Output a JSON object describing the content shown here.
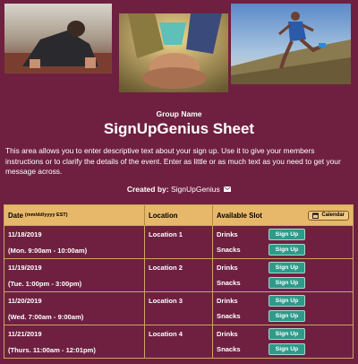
{
  "header": {
    "group_name": "Group Name",
    "title": "SignUpGenius Sheet",
    "description": "This area allows you to enter descriptive text about your sign up. Use it to give your members instructions or to clarify the details of the event. Enter as little or as much text as you need to get your message across.",
    "created_by_label": "Created by:",
    "created_by_name": "SignUpGenius",
    "mail_icon": "mail-icon"
  },
  "table": {
    "col_date": "Date",
    "col_date_format": "(mm/dd/yyyy EST)",
    "col_location": "Location",
    "col_slot": "Available Slot",
    "calendar_label": "Calendar",
    "signup_label": "Sign Up",
    "rows": [
      {
        "date": "11/18/2019",
        "time": "(Mon. 9:00am - 10:00am)",
        "location": "Location 1",
        "slots": [
          "Drinks",
          "Snacks"
        ]
      },
      {
        "date": "11/19/2019",
        "time": "(Tue. 1:00pm - 3:00pm)",
        "location": "Location 2",
        "slots": [
          "Drinks",
          "Snacks"
        ]
      },
      {
        "date": "11/20/2019",
        "time": "(Wed. 7:00am - 9:00am)",
        "location": "Location 3",
        "slots": [
          "Drinks",
          "Snacks"
        ]
      },
      {
        "date": "11/21/2019",
        "time": "(Thurs. 11:00am - 12:01pm)",
        "location": "Location 4",
        "slots": [
          "Drinks",
          "Snacks"
        ]
      }
    ]
  },
  "colors": {
    "background": "#6f2040",
    "header_row": "#e8b86a",
    "signup_button": "#2e9a8a"
  }
}
